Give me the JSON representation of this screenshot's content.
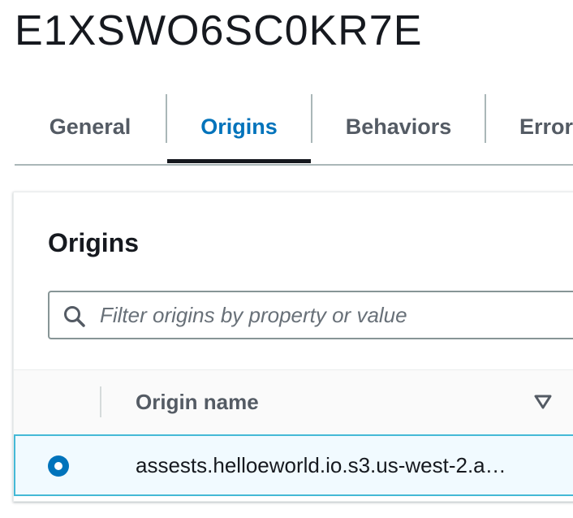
{
  "distribution": {
    "id": "E1XSWO6SC0KR7E"
  },
  "tabs": [
    {
      "label": "General",
      "active": false
    },
    {
      "label": "Origins",
      "active": true
    },
    {
      "label": "Behaviors",
      "active": false
    },
    {
      "label": "Error",
      "active": false
    }
  ],
  "origins_panel": {
    "title": "Origins",
    "filter": {
      "placeholder": "Filter origins by property or value",
      "value": "",
      "icon": "search-icon"
    },
    "table": {
      "columns": [
        {
          "label": "Origin name",
          "sort_icon": "sort-descending-icon"
        }
      ],
      "rows": [
        {
          "selected": true,
          "origin_name": "assests.helloeworld.io.s3.us-west-2.a…"
        }
      ]
    }
  },
  "colors": {
    "accent": "#0073bb",
    "selected_row_bg": "#f1faff",
    "selected_row_border": "#44b9d6",
    "text": "#16191f",
    "muted_text": "#545b64"
  }
}
